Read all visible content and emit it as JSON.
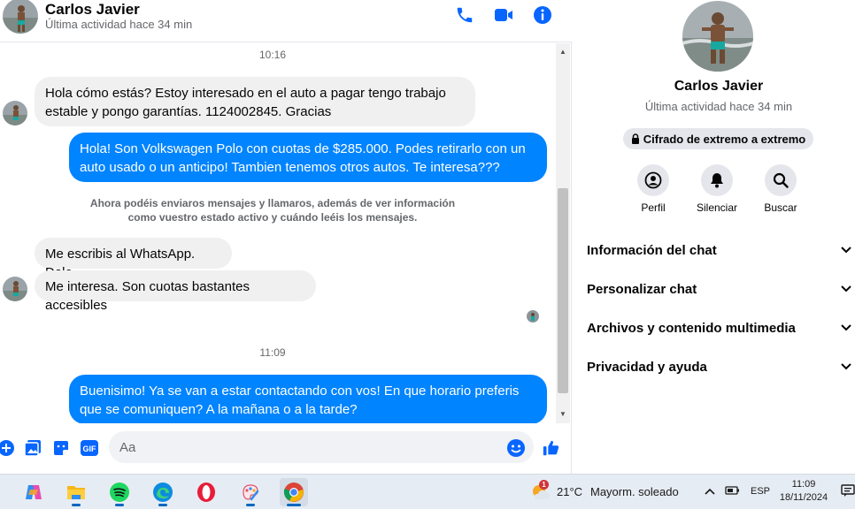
{
  "contact": {
    "name": "Carlos Javier",
    "status": "Última actividad hace 34 min"
  },
  "header_actions": [
    "phone-icon",
    "video-call-icon",
    "info-icon"
  ],
  "messages": {
    "time1": "10:16",
    "msg1": "Hola cómo estás? Estoy interesado en el auto a pagar tengo trabajo estable y pongo garantías. 1124002845. Gracias",
    "msg2": "Hola! Son Volkswagen Polo con cuotas de $285.000. Podes retirarlo con un auto usado o un anticipo! Tambien tenemos otros autos. Te interesa???",
    "notice": "Ahora podéis enviaros mensajes y llamaros, además de ver información como vuestro estado activo y cuándo leéis los mensajes.",
    "msg3": "Me escribis al WhatsApp. Dale",
    "msg4": "Me interesa. Son cuotas bastantes accesibles",
    "time2": "11:09",
    "msg5": "Buenisimo! Ya se van a estar contactando con vos! En que horario preferis que se comuniquen? A la mañana o a la tarde?"
  },
  "composer": {
    "placeholder": "Aa",
    "value": ""
  },
  "info_panel": {
    "name": "Carlos Javier",
    "status": "Última actividad hace 34 min",
    "encryption": "Cifrado de extremo a extremo",
    "actions": [
      "Perfil",
      "Silenciar",
      "Buscar"
    ],
    "sections": [
      "Información del chat",
      "Personalizar chat",
      "Archivos y contenido multimedia",
      "Privacidad y ayuda"
    ]
  },
  "taskbar": {
    "apps": [
      "copilot-icon",
      "file-explorer-icon",
      "spotify-icon",
      "edge-icon",
      "opera-icon",
      "paint-icon",
      "chrome-icon"
    ],
    "weather_badge": "1",
    "temperature": "21°C",
    "weather": "Mayorm. soleado",
    "language": "ESP",
    "time": "11:09",
    "date": "18/11/2024"
  },
  "colors": {
    "accent": "#0084ff",
    "incoming_bubble": "#f0f0f0",
    "icon_blue": "#0866ff",
    "secondary_text": "#65676b"
  }
}
